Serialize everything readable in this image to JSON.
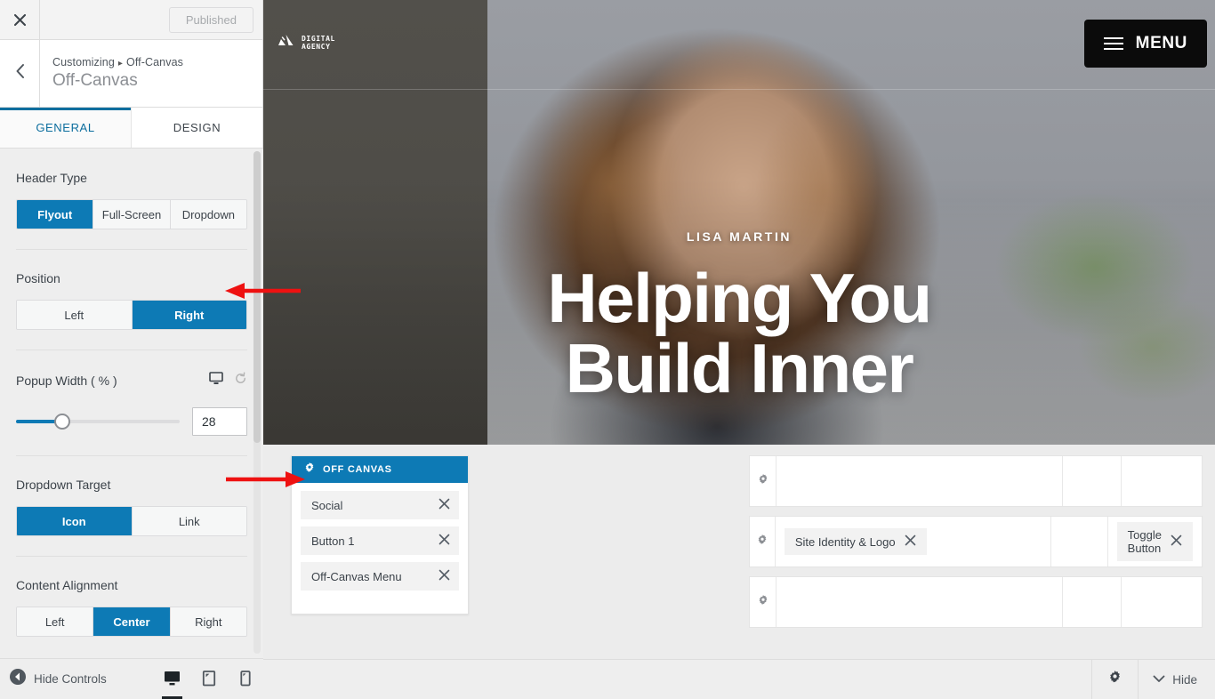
{
  "customizer": {
    "close_icon": "close-icon",
    "publish_button": "Published",
    "back_icon": "chevron-left-icon",
    "breadcrumb_root": "Customizing",
    "breadcrumb_sep": "▸",
    "breadcrumb_current": "Off-Canvas",
    "panel_title": "Off-Canvas",
    "tabs": [
      {
        "label": "GENERAL",
        "active": true
      },
      {
        "label": "DESIGN",
        "active": false
      }
    ],
    "controls": [
      {
        "label": "Header Type",
        "type": "button-group",
        "options": [
          "Flyout",
          "Full-Screen",
          "Dropdown"
        ],
        "selected": "Flyout"
      },
      {
        "label": "Position",
        "type": "button-group",
        "options": [
          "Left",
          "Right"
        ],
        "selected": "Right"
      },
      {
        "label": "Popup Width ( % )",
        "type": "slider",
        "value": "28",
        "percent": 28,
        "responsive_icon": "desktop-icon",
        "reset_icon": "reset-icon"
      },
      {
        "label": "Dropdown Target",
        "type": "button-group",
        "options": [
          "Icon",
          "Link"
        ],
        "selected": "Icon"
      },
      {
        "label": "Content Alignment",
        "type": "button-group",
        "options": [
          "Left",
          "Center",
          "Right"
        ],
        "selected": "Center"
      }
    ],
    "footer": {
      "hide_controls_label": "Hide Controls",
      "collapse_icon": "collapse-left-icon",
      "devices": [
        {
          "name": "desktop",
          "icon": "desktop-icon",
          "active": true
        },
        {
          "name": "tablet",
          "icon": "tablet-icon",
          "active": false
        },
        {
          "name": "mobile",
          "icon": "mobile-icon",
          "active": false
        }
      ]
    }
  },
  "preview": {
    "site_logo": {
      "icon": "mountain-logo-icon",
      "line1": "DIGITAL",
      "line2": "AGENCY"
    },
    "menu_button": {
      "icon": "hamburger-icon",
      "label": "MENU"
    },
    "hero": {
      "eyebrow": "LISA MARTIN",
      "title_line1": "Helping You",
      "title_line2": "Build Inner"
    },
    "offcanvas_panel": {
      "gear_icon": "gear-icon",
      "title": "OFF CANVAS",
      "items": [
        {
          "label": "Social",
          "remove_icon": "close-icon"
        },
        {
          "label": "Button 1",
          "remove_icon": "close-icon"
        },
        {
          "label": "Off-Canvas Menu",
          "remove_icon": "close-icon"
        }
      ]
    },
    "builder_rows": [
      {
        "gear_icon": "gear-icon",
        "left_chip": null,
        "right_chip": null
      },
      {
        "gear_icon": "gear-icon",
        "left_chip": {
          "label": "Site Identity & Logo",
          "remove_icon": "close-icon"
        },
        "right_chip": {
          "label": "Toggle Button",
          "remove_icon": "close-icon"
        }
      },
      {
        "gear_icon": "gear-icon",
        "left_chip": null,
        "right_chip": null
      }
    ],
    "footer": {
      "settings_icon": "gear-icon",
      "hide_label": "Hide",
      "hide_icon": "chevron-down-icon"
    }
  },
  "annotations": [
    {
      "name": "arrow-to-position",
      "direction": "left",
      "color": "#ee1111"
    },
    {
      "name": "arrow-to-offcanvas",
      "direction": "right",
      "color": "#ee1111"
    }
  ],
  "colors": {
    "accent_blue": "#0d7ab5",
    "tab_active": "#0d6e9e",
    "annotation_red": "#ee1111",
    "panel_bg": "#eeeeee",
    "menu_button_bg": "#0b0b0b"
  }
}
